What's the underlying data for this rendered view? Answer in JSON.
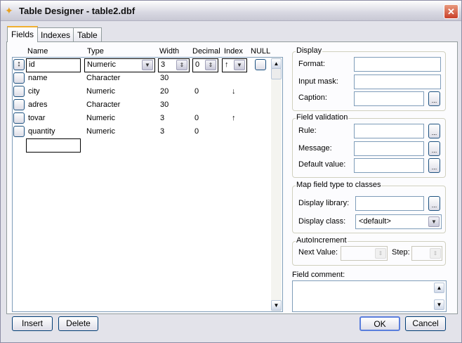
{
  "window": {
    "title": "Table Designer - table2.dbf",
    "close": "✕"
  },
  "tabs": [
    {
      "label": "Fields"
    },
    {
      "label": "Indexes"
    },
    {
      "label": "Table"
    }
  ],
  "grid": {
    "headers": [
      "Name",
      "Type",
      "Width",
      "Decimal",
      "Index",
      "NULL"
    ],
    "rows": [
      {
        "name": "id",
        "type": "Numeric",
        "width": "3",
        "decimal": "0",
        "index": "↑"
      },
      {
        "name": "name",
        "type": "Character",
        "width": "30",
        "decimal": "",
        "index": ""
      },
      {
        "name": "city",
        "type": "Numeric",
        "width": "20",
        "decimal": "0",
        "index": "↓"
      },
      {
        "name": "adres",
        "type": "Character",
        "width": "30",
        "decimal": "",
        "index": ""
      },
      {
        "name": "tovar",
        "type": "Numeric",
        "width": "3",
        "decimal": "0",
        "index": "↑"
      },
      {
        "name": "quantity",
        "type": "Numeric",
        "width": "3",
        "decimal": "0",
        "index": ""
      }
    ]
  },
  "display": {
    "title": "Display",
    "format": "Format:",
    "input_mask": "Input mask:",
    "caption": "Caption:"
  },
  "validation": {
    "title": "Field validation",
    "rule": "Rule:",
    "message": "Message:",
    "default": "Default value:"
  },
  "map": {
    "title": "Map field type to classes",
    "library": "Display library:",
    "class": "Display class:",
    "class_value": "<default>"
  },
  "autoinc": {
    "title": "AutoIncrement",
    "next": "Next Value:",
    "step": "Step:"
  },
  "comment": {
    "label": "Field comment:"
  },
  "buttons": {
    "insert": "Insert",
    "delete": "Delete",
    "ok": "OK",
    "cancel": "Cancel",
    "ellipsis": "..."
  }
}
